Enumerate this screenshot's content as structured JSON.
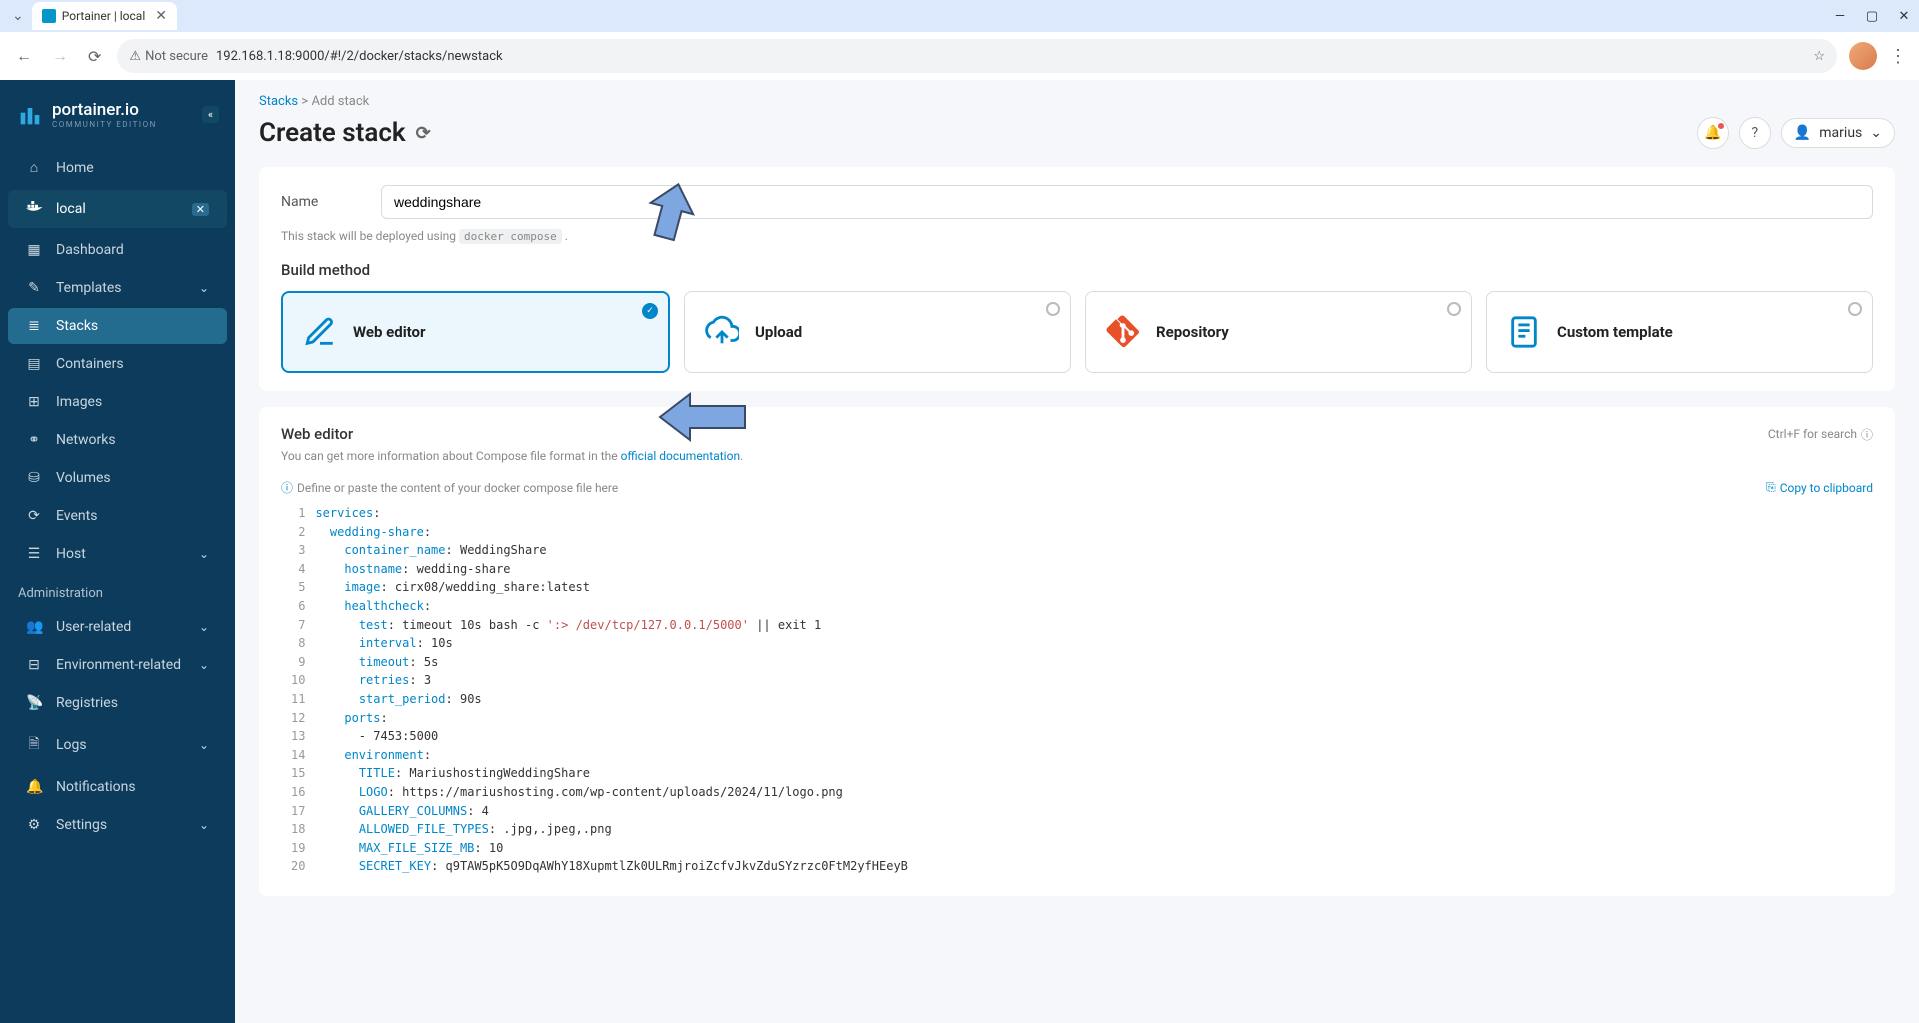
{
  "browser": {
    "tab_title": "Portainer | local",
    "not_secure": "Not secure",
    "url": "192.168.1.18:9000/#!/2/docker/stacks/newstack"
  },
  "sidebar": {
    "logo_name": "portainer.io",
    "logo_subtitle": "COMMUNITY EDITION",
    "items_top": [
      {
        "label": "Home",
        "icon": "⌂"
      }
    ],
    "env_label": "local",
    "items_env": [
      {
        "label": "Dashboard",
        "icon": "▦"
      },
      {
        "label": "Templates",
        "icon": "✎",
        "chevron": true
      },
      {
        "label": "Stacks",
        "icon": "≣",
        "active": true
      },
      {
        "label": "Containers",
        "icon": "▤"
      },
      {
        "label": "Images",
        "icon": "⊞"
      },
      {
        "label": "Networks",
        "icon": "⚭"
      },
      {
        "label": "Volumes",
        "icon": "⛁"
      },
      {
        "label": "Events",
        "icon": "⟳"
      },
      {
        "label": "Host",
        "icon": "☰",
        "chevron": true
      }
    ],
    "admin_label": "Administration",
    "items_admin": [
      {
        "label": "User-related",
        "icon": "👥",
        "chevron": true
      },
      {
        "label": "Environment-related",
        "icon": "⊟",
        "chevron": true
      },
      {
        "label": "Registries",
        "icon": "📡"
      },
      {
        "label": "Logs",
        "icon": "🗎",
        "chevron": true
      },
      {
        "label": "Notifications",
        "icon": "🔔"
      },
      {
        "label": "Settings",
        "icon": "⚙",
        "chevron": true
      }
    ]
  },
  "header": {
    "breadcrumb_root": "Stacks",
    "breadcrumb_sep": ">",
    "breadcrumb_current": "Add stack",
    "title": "Create stack",
    "user": "marius"
  },
  "form": {
    "name_label": "Name",
    "name_value": "weddingshare",
    "deploy_hint": "This stack will be deployed using",
    "deploy_code": "docker compose",
    "build_method": "Build method",
    "options": [
      {
        "label": "Web editor",
        "selected": true,
        "icon": "edit"
      },
      {
        "label": "Upload",
        "icon": "upload"
      },
      {
        "label": "Repository",
        "icon": "git"
      },
      {
        "label": "Custom template",
        "icon": "template"
      }
    ]
  },
  "editor": {
    "title": "Web editor",
    "search_hint": "Ctrl+F for search",
    "desc_prefix": "You can get more information about Compose file format in the ",
    "desc_link": "official documentation",
    "define_hint": "Define or paste the content of your docker compose file here",
    "copy_label": "Copy to clipboard",
    "lines": [
      {
        "n": 1,
        "indent": 0,
        "key": "services",
        "val": ""
      },
      {
        "n": 2,
        "indent": 1,
        "key": "wedding-share",
        "val": ""
      },
      {
        "n": 3,
        "indent": 2,
        "key": "container_name",
        "val": " WeddingShare"
      },
      {
        "n": 4,
        "indent": 2,
        "key": "hostname",
        "val": " wedding-share"
      },
      {
        "n": 5,
        "indent": 2,
        "key": "image",
        "val": " cirx08/wedding_share:latest"
      },
      {
        "n": 6,
        "indent": 2,
        "key": "healthcheck",
        "val": ""
      },
      {
        "n": 7,
        "indent": 3,
        "key": "test",
        "val": " timeout 10s bash -c ",
        "str": "':> /dev/tcp/127.0.0.1/5000'",
        "tail": " || exit 1"
      },
      {
        "n": 8,
        "indent": 3,
        "key": "interval",
        "val": " 10s"
      },
      {
        "n": 9,
        "indent": 3,
        "key": "timeout",
        "val": " 5s"
      },
      {
        "n": 10,
        "indent": 3,
        "key": "retries",
        "val": " 3"
      },
      {
        "n": 11,
        "indent": 3,
        "key": "start_period",
        "val": " 90s"
      },
      {
        "n": 12,
        "indent": 2,
        "key": "ports",
        "val": ""
      },
      {
        "n": 13,
        "indent": 3,
        "plain": "- 7453:5000"
      },
      {
        "n": 14,
        "indent": 2,
        "key": "environment",
        "val": ""
      },
      {
        "n": 15,
        "indent": 3,
        "key": "TITLE",
        "val": " MariushostingWeddingShare"
      },
      {
        "n": 16,
        "indent": 3,
        "key": "LOGO",
        "val": " https://mariushosting.com/wp-content/uploads/2024/11/logo.png"
      },
      {
        "n": 17,
        "indent": 3,
        "key": "GALLERY_COLUMNS",
        "val": " 4"
      },
      {
        "n": 18,
        "indent": 3,
        "key": "ALLOWED_FILE_TYPES",
        "val": " .jpg,.jpeg,.png"
      },
      {
        "n": 19,
        "indent": 3,
        "key": "MAX_FILE_SIZE_MB",
        "val": " 10"
      },
      {
        "n": 20,
        "indent": 3,
        "key": "SECRET_KEY",
        "val": " q9TAW5pK5O9DqAWhY18XupmtlZk0ULRmjroiZcfvJkvZduSYzrzc0FtM2yfHEeyB"
      }
    ]
  }
}
